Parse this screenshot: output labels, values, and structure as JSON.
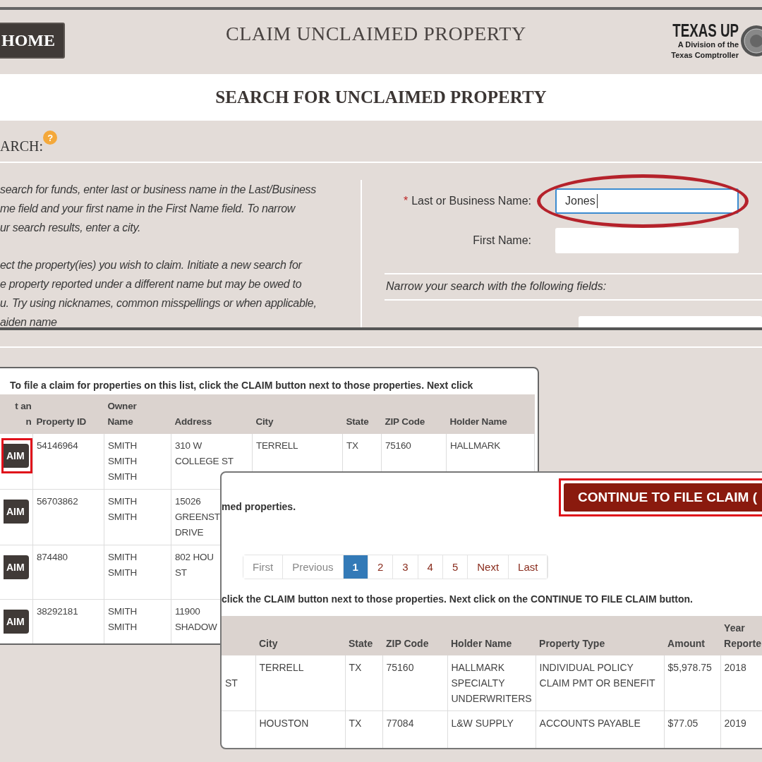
{
  "header": {
    "home_button": "HOME",
    "title": "CLAIM UNCLAIMED PROPERTY",
    "logo": {
      "name": "TEXAS UP",
      "lines": [
        "A Division of the",
        "Texas Comptroller"
      ]
    }
  },
  "search_banner": "SEARCH FOR UNCLAIMED PROPERTY",
  "search_label": "ARCH:",
  "help_badge": "?",
  "instructions": [
    [
      "search for funds, enter last or business name in the Last/Business",
      "me field and your first name in the First Name field. To narrow",
      "ur search results, enter a city."
    ],
    [
      "ect the property(ies) you wish to claim. Initiate a new search for",
      "e property reported under a different name but may be owed to",
      "u. Try using nicknames, common misspellings or when applicable,",
      "aiden name"
    ]
  ],
  "form": {
    "fields": [
      {
        "required_mark": "*",
        "label": "Last or Business Name:",
        "value": "Jones",
        "focused": true,
        "highlighted": true
      },
      {
        "label": "First Name:",
        "focused": false,
        "highlighted": false
      }
    ],
    "narrow_note": "Narrow your search with the following fields:"
  },
  "results_list": {
    "note": "To file a claim for properties on this list, click the CLAIM button next to those properties. Next click",
    "columns": [
      "t an\nn",
      "Property ID",
      "Owner\nName",
      "Address",
      "City",
      "State",
      "ZIP Code",
      "Holder Name"
    ],
    "rows": [
      {
        "cells": [
          {
            "kind": "claim_button",
            "label": "AIM",
            "highlighted": true
          },
          "54146964",
          "SMITH\nSMITH\nSMITH",
          "310 W\nCOLLEGE ST",
          "TERRELL",
          "TX",
          "75160",
          "HALLMARK"
        ]
      },
      {
        "cells": [
          {
            "kind": "claim_button",
            "label": "AIM",
            "highlighted": false
          },
          "56703862",
          "SMITH\nSMITH",
          "15026\nGREENST\nDRIVE"
        ]
      },
      {
        "cells": [
          {
            "kind": "claim_button",
            "label": "AIM",
            "highlighted": false
          },
          "874480",
          "SMITH\nSMITH",
          "802 HOU\nST"
        ]
      },
      {
        "cells": [
          {
            "kind": "claim_button",
            "label": "AIM",
            "highlighted": false
          },
          "38292181",
          "SMITH\nSMITH",
          "11900\nSHADOW"
        ]
      }
    ]
  },
  "results_continued": {
    "note": "med properties.",
    "continue_button": {
      "label": "CONTINUE TO FILE CLAIM (",
      "highlighted": true
    },
    "pagination": [
      {
        "label": "First",
        "selected": false,
        "disabled": true
      },
      {
        "label": "Previous",
        "selected": false,
        "disabled": true
      },
      {
        "label": "1",
        "selected": true,
        "disabled": false
      },
      {
        "label": "2",
        "selected": false,
        "disabled": false
      },
      {
        "label": "3",
        "selected": false,
        "disabled": false
      },
      {
        "label": "4",
        "selected": false,
        "disabled": false
      },
      {
        "label": "5",
        "selected": false,
        "disabled": false
      },
      {
        "label": "Next",
        "selected": false,
        "disabled": false
      },
      {
        "label": "Last",
        "selected": false,
        "disabled": false
      }
    ],
    "note_2": "click the CLAIM button next to those properties. Next click on the CONTINUE TO FILE CLAIM button.",
    "columns": [
      null,
      "City",
      "State",
      "ZIP Code",
      "Holder Name",
      "Property Type",
      "Amount",
      "Year\nReporte"
    ],
    "rows": [
      {
        "cells": [
          "ST",
          "TERRELL",
          "TX",
          "75160",
          "HALLMARK\nSPECIALTY\nUNDERWRITERS",
          "INDIVIDUAL POLICY\nCLAIM PMT OR BENEFIT",
          "$5,978.75",
          "2018"
        ]
      },
      {
        "cells": [
          null,
          "HOUSTON",
          "TX",
          "77084",
          "L&W SUPPLY",
          "ACCOUNTS PAYABLE",
          "$77.05",
          "2019"
        ]
      }
    ]
  }
}
